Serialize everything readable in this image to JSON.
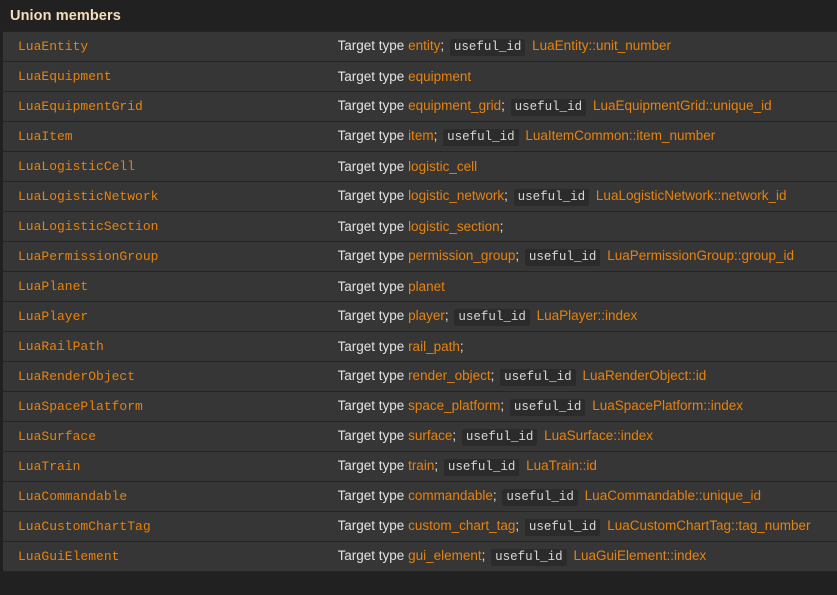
{
  "page": {
    "title": "Union members",
    "background_color": "#212121",
    "cell_color": "#363636",
    "link_color": "#e8820c",
    "heading_color": "#f5ddbd",
    "text_color": "#e3e3e3",
    "code_background_color": "#2b2b2b"
  },
  "labels": {
    "target_type_prefix": "Target type",
    "useful_id_code": "useful_id",
    "semicolon": ";"
  },
  "rows": [
    {
      "name": "LuaEntity",
      "target_type": "entity",
      "semicolon": ";",
      "useful_id_label": "useful_id",
      "useful_id_ref": "LuaEntity::unit_number"
    },
    {
      "name": "LuaEquipment",
      "target_type": "equipment",
      "semicolon": "",
      "useful_id_label": "",
      "useful_id_ref": ""
    },
    {
      "name": "LuaEquipmentGrid",
      "target_type": "equipment_grid",
      "semicolon": ";",
      "useful_id_label": "useful_id",
      "useful_id_ref": "LuaEquipmentGrid::unique_id"
    },
    {
      "name": "LuaItem",
      "target_type": "item",
      "semicolon": ";",
      "useful_id_label": "useful_id",
      "useful_id_ref": "LuaItemCommon::item_number"
    },
    {
      "name": "LuaLogisticCell",
      "target_type": "logistic_cell",
      "semicolon": "",
      "useful_id_label": "",
      "useful_id_ref": ""
    },
    {
      "name": "LuaLogisticNetwork",
      "target_type": "logistic_network",
      "semicolon": ";",
      "useful_id_label": "useful_id",
      "useful_id_ref": "LuaLogisticNetwork::network_id"
    },
    {
      "name": "LuaLogisticSection",
      "target_type": "logistic_section",
      "semicolon": ";",
      "useful_id_label": "",
      "useful_id_ref": ""
    },
    {
      "name": "LuaPermissionGroup",
      "target_type": "permission_group",
      "semicolon": ";",
      "useful_id_label": "useful_id",
      "useful_id_ref": "LuaPermissionGroup::group_id"
    },
    {
      "name": "LuaPlanet",
      "target_type": "planet",
      "semicolon": "",
      "useful_id_label": "",
      "useful_id_ref": ""
    },
    {
      "name": "LuaPlayer",
      "target_type": "player",
      "semicolon": ";",
      "useful_id_label": "useful_id",
      "useful_id_ref": "LuaPlayer::index"
    },
    {
      "name": "LuaRailPath",
      "target_type": "rail_path",
      "semicolon": ";",
      "useful_id_label": "",
      "useful_id_ref": ""
    },
    {
      "name": "LuaRenderObject",
      "target_type": "render_object",
      "semicolon": ";",
      "useful_id_label": "useful_id",
      "useful_id_ref": "LuaRenderObject::id"
    },
    {
      "name": "LuaSpacePlatform",
      "target_type": "space_platform",
      "semicolon": ";",
      "useful_id_label": "useful_id",
      "useful_id_ref": "LuaSpacePlatform::index"
    },
    {
      "name": "LuaSurface",
      "target_type": "surface",
      "semicolon": ";",
      "useful_id_label": "useful_id",
      "useful_id_ref": "LuaSurface::index"
    },
    {
      "name": "LuaTrain",
      "target_type": "train",
      "semicolon": ";",
      "useful_id_label": "useful_id",
      "useful_id_ref": "LuaTrain::id"
    },
    {
      "name": "LuaCommandable",
      "target_type": "commandable",
      "semicolon": ";",
      "useful_id_label": "useful_id",
      "useful_id_ref": "LuaCommandable::unique_id"
    },
    {
      "name": "LuaCustomChartTag",
      "target_type": "custom_chart_tag",
      "semicolon": ";",
      "useful_id_label": "useful_id",
      "useful_id_ref": "LuaCustomChartTag::tag_number"
    },
    {
      "name": "LuaGuiElement",
      "target_type": "gui_element",
      "semicolon": ";",
      "useful_id_label": "useful_id",
      "useful_id_ref": "LuaGuiElement::index"
    }
  ]
}
